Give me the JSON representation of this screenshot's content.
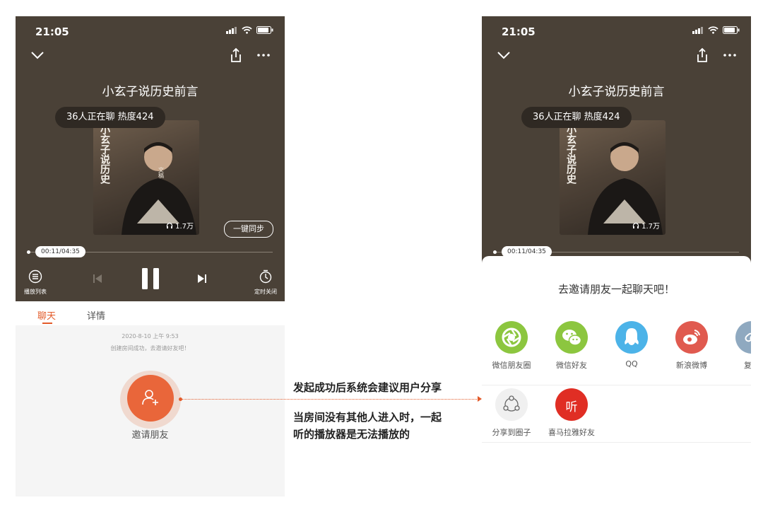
{
  "left_screen": {
    "status_time": "21:05",
    "title": "小玄子说历史前言",
    "chat_pill": "36人正在聊 热度424",
    "cover": {
      "calligraphy": "小玄子说历史",
      "play_count": "1.7万"
    },
    "sync_button": "一键同步",
    "progress_time": "00:11/04:35",
    "progress": 0.04,
    "controls": {
      "playlist_label": "播放列表",
      "timer_label": "定时关闭"
    },
    "tabs": {
      "chat": "聊天",
      "detail": "详情"
    },
    "chat": {
      "timestamp": "2020-8-10 上午 9:53",
      "system_message": "创建房间成功，去邀请好友吧！",
      "invite_label": "邀请朋友"
    }
  },
  "right_screen": {
    "status_time": "21:05",
    "title": "小玄子说历史前言",
    "chat_pill": "36人正在聊 热度424",
    "cover": {
      "calligraphy": "小玄子说历史",
      "play_count": "1.7万"
    },
    "progress_time": "00:11/04:35",
    "share_sheet": {
      "title": "去邀请朋友一起聊天吧！",
      "row1": [
        {
          "label": "微信朋友圈",
          "icon": "wechat-moments-icon",
          "color": "#8cc63f"
        },
        {
          "label": "微信好友",
          "icon": "wechat-icon",
          "color": "#8cc63f"
        },
        {
          "label": "QQ",
          "icon": "qq-icon",
          "color": "#4cb3e8"
        },
        {
          "label": "新浪微博",
          "icon": "weibo-icon",
          "color": "#e05a4f"
        },
        {
          "label": "复制",
          "icon": "copy-link-icon",
          "color": "#8fa9c0"
        }
      ],
      "row2": [
        {
          "label": "分享到圈子",
          "icon": "circle-share-icon",
          "color": "#f0f0f0"
        },
        {
          "label": "喜马拉雅好友",
          "icon": "ximalaya-icon",
          "color": "#e02e24",
          "glyph": "听"
        }
      ]
    }
  },
  "annotation": {
    "line1": "发起成功后系统会建议用户分享",
    "line2": "当房间没有其他人进入时，一起",
    "line3": "听的播放器是无法播放的"
  },
  "colors": {
    "accent": "#e35b2a",
    "player_bg": "#4a4137"
  }
}
